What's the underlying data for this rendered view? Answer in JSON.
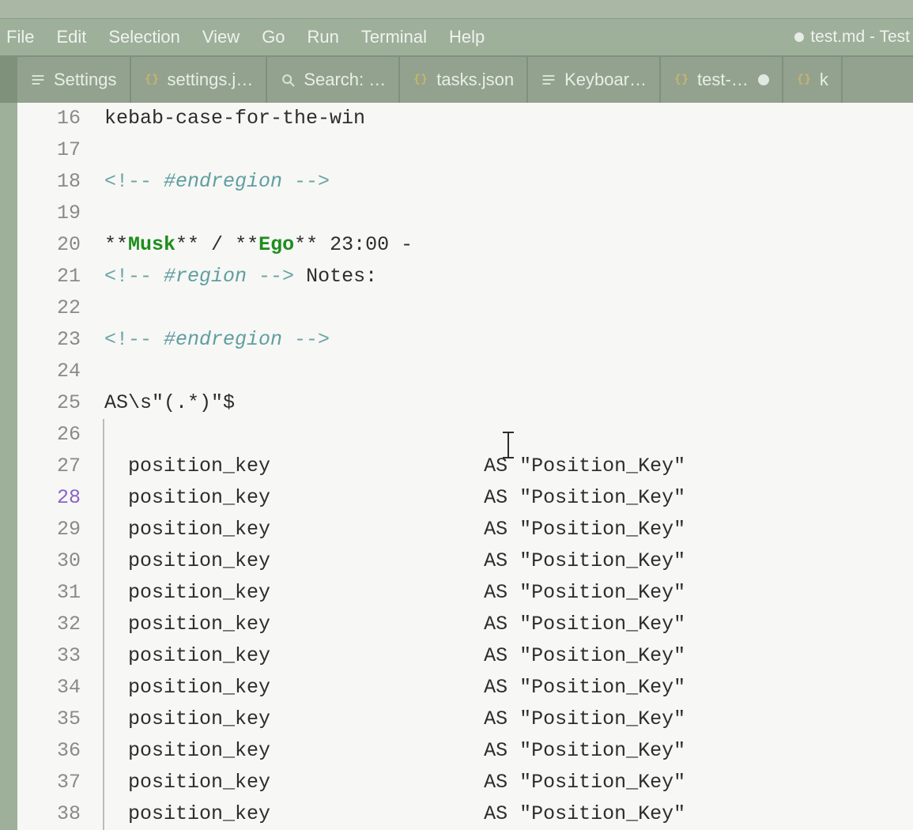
{
  "menubar": {
    "items": [
      "File",
      "Edit",
      "Selection",
      "View",
      "Go",
      "Run",
      "Terminal",
      "Help"
    ],
    "window_title": "test.md - Test"
  },
  "tabs": [
    {
      "icon": "lines",
      "label": "Settings",
      "dirty": false
    },
    {
      "icon": "braces",
      "label": "settings.j…",
      "dirty": false
    },
    {
      "icon": "search",
      "label": "Search: …",
      "dirty": false
    },
    {
      "icon": "braces",
      "label": "tasks.json",
      "dirty": false
    },
    {
      "icon": "lines",
      "label": "Keyboar…",
      "dirty": false
    },
    {
      "icon": "braces",
      "label": "test-…",
      "dirty": true
    },
    {
      "icon": "braces",
      "label": "k",
      "dirty": false
    }
  ],
  "editor": {
    "active_line": 28,
    "lines": [
      {
        "n": 16,
        "kind": "plain",
        "text": "kebab-case-for-the-win"
      },
      {
        "n": 17,
        "kind": "plain",
        "text": ""
      },
      {
        "n": 18,
        "kind": "endregion"
      },
      {
        "n": 19,
        "kind": "plain",
        "text": ""
      },
      {
        "n": 20,
        "kind": "bold2",
        "a": "Musk",
        "b": "Ego",
        "tail": " 23:00 -"
      },
      {
        "n": 21,
        "kind": "region",
        "tail": "Notes:"
      },
      {
        "n": 22,
        "kind": "plain",
        "text": ""
      },
      {
        "n": 23,
        "kind": "endregion"
      },
      {
        "n": 24,
        "kind": "plain",
        "text": ""
      },
      {
        "n": 25,
        "kind": "plain",
        "text": "AS\\s\"(.*)\"$"
      },
      {
        "n": 26,
        "kind": "guided",
        "text": ""
      },
      {
        "n": 27,
        "kind": "sql"
      },
      {
        "n": 28,
        "kind": "sql"
      },
      {
        "n": 29,
        "kind": "sql"
      },
      {
        "n": 30,
        "kind": "sql"
      },
      {
        "n": 31,
        "kind": "sql"
      },
      {
        "n": 32,
        "kind": "sql"
      },
      {
        "n": 33,
        "kind": "sql"
      },
      {
        "n": 34,
        "kind": "sql"
      },
      {
        "n": 35,
        "kind": "sql"
      },
      {
        "n": 36,
        "kind": "sql"
      },
      {
        "n": 37,
        "kind": "sql"
      },
      {
        "n": 38,
        "kind": "sql"
      }
    ],
    "sql_row": {
      "left": "position_key",
      "right": "AS \"Position_Key\""
    }
  },
  "colors": {
    "chrome": "#9eaf9a",
    "tabbar": "#92a28e",
    "gutter": "#7f917b",
    "editor_bg": "#f7f7f5"
  }
}
